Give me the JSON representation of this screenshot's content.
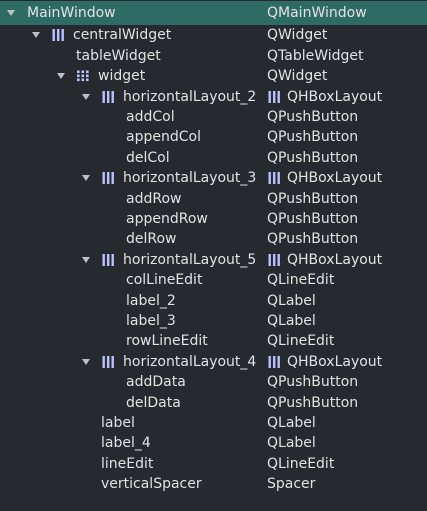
{
  "tree": [
    {
      "name": "MainWindow",
      "class": "QMainWindow",
      "depth": 0,
      "expanded": true,
      "icon": "",
      "selected": true
    },
    {
      "name": "centralWidget",
      "class": "QWidget",
      "depth": 1,
      "expanded": true,
      "icon": "vbox-layout-icon"
    },
    {
      "name": "tableWidget",
      "class": "QTableWidget",
      "depth": 2,
      "icon": ""
    },
    {
      "name": "widget",
      "class": "QWidget",
      "depth": 2,
      "expanded": true,
      "icon": "grid-layout-icon"
    },
    {
      "name": "horizontalLayout_2",
      "class": "QHBoxLayout",
      "depth": 3,
      "expanded": true,
      "icon": "hbox-layout-icon",
      "class_icon": "hbox-layout-icon"
    },
    {
      "name": "addCol",
      "class": "QPushButton",
      "depth": 4,
      "icon": ""
    },
    {
      "name": "appendCol",
      "class": "QPushButton",
      "depth": 4,
      "icon": ""
    },
    {
      "name": "delCol",
      "class": "QPushButton",
      "depth": 4,
      "icon": ""
    },
    {
      "name": "horizontalLayout_3",
      "class": "QHBoxLayout",
      "depth": 3,
      "expanded": true,
      "icon": "hbox-layout-icon",
      "class_icon": "hbox-layout-icon"
    },
    {
      "name": "addRow",
      "class": "QPushButton",
      "depth": 4,
      "icon": ""
    },
    {
      "name": "appendRow",
      "class": "QPushButton",
      "depth": 4,
      "icon": ""
    },
    {
      "name": "delRow",
      "class": "QPushButton",
      "depth": 4,
      "icon": ""
    },
    {
      "name": "horizontalLayout_5",
      "class": "QHBoxLayout",
      "depth": 3,
      "expanded": true,
      "icon": "hbox-layout-icon",
      "class_icon": "hbox-layout-icon"
    },
    {
      "name": "colLineEdit",
      "class": "QLineEdit",
      "depth": 4,
      "icon": ""
    },
    {
      "name": "label_2",
      "class": "QLabel",
      "depth": 4,
      "icon": ""
    },
    {
      "name": "label_3",
      "class": "QLabel",
      "depth": 4,
      "icon": ""
    },
    {
      "name": "rowLineEdit",
      "class": "QLineEdit",
      "depth": 4,
      "icon": ""
    },
    {
      "name": "horizontalLayout_4",
      "class": "QHBoxLayout",
      "depth": 3,
      "expanded": true,
      "icon": "hbox-layout-icon",
      "class_icon": "hbox-layout-icon"
    },
    {
      "name": "addData",
      "class": "QPushButton",
      "depth": 4,
      "icon": ""
    },
    {
      "name": "delData",
      "class": "QPushButton",
      "depth": 4,
      "icon": ""
    },
    {
      "name": "label",
      "class": "QLabel",
      "depth": 3,
      "icon": ""
    },
    {
      "name": "label_4",
      "class": "QLabel",
      "depth": 3,
      "icon": ""
    },
    {
      "name": "lineEdit",
      "class": "QLineEdit",
      "depth": 3,
      "icon": ""
    },
    {
      "name": "verticalSpacer",
      "class": "Spacer",
      "depth": 3,
      "icon": ""
    }
  ],
  "colors": {
    "background": "#262a2e",
    "selection": "#2f6b65",
    "text": "#e2e2e2",
    "icon": "#b9c2ff"
  }
}
